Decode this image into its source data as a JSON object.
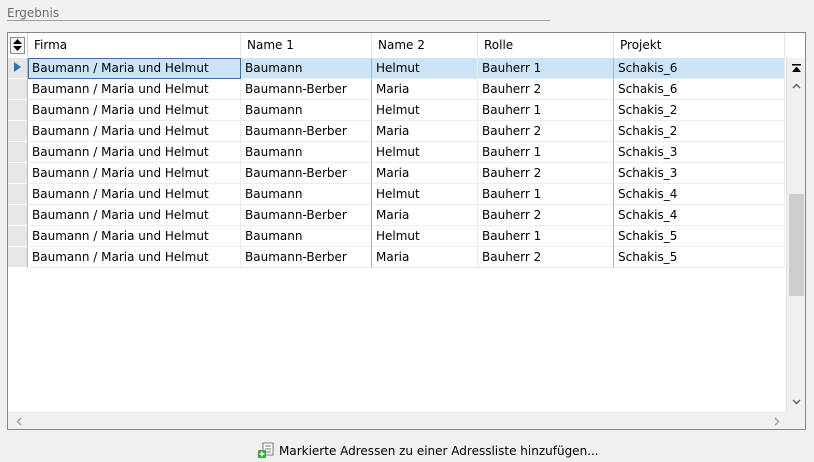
{
  "group": {
    "title": "Ergebnis"
  },
  "columns": [
    {
      "key": "firma",
      "label": "Firma"
    },
    {
      "key": "name1",
      "label": "Name 1"
    },
    {
      "key": "name2",
      "label": "Name 2"
    },
    {
      "key": "rolle",
      "label": "Rolle"
    },
    {
      "key": "projekt",
      "label": "Projekt"
    }
  ],
  "rows": [
    {
      "firma": "Baumann / Maria und Helmut",
      "name1": "Baumann",
      "name2": "Helmut",
      "rolle": "Bauherr 1",
      "projekt": "Schakis_6",
      "selected": true
    },
    {
      "firma": "Baumann / Maria und Helmut",
      "name1": "Baumann-Berber",
      "name2": "Maria",
      "rolle": "Bauherr 2",
      "projekt": "Schakis_6"
    },
    {
      "firma": "Baumann / Maria und Helmut",
      "name1": "Baumann",
      "name2": "Helmut",
      "rolle": "Bauherr 1",
      "projekt": "Schakis_2"
    },
    {
      "firma": "Baumann / Maria und Helmut",
      "name1": "Baumann-Berber",
      "name2": "Maria",
      "rolle": "Bauherr 2",
      "projekt": "Schakis_2"
    },
    {
      "firma": "Baumann / Maria und Helmut",
      "name1": "Baumann",
      "name2": "Helmut",
      "rolle": "Bauherr 1",
      "projekt": "Schakis_3"
    },
    {
      "firma": "Baumann / Maria und Helmut",
      "name1": "Baumann-Berber",
      "name2": "Maria",
      "rolle": "Bauherr 2",
      "projekt": "Schakis_3"
    },
    {
      "firma": "Baumann / Maria und Helmut",
      "name1": "Baumann",
      "name2": "Helmut",
      "rolle": "Bauherr 1",
      "projekt": "Schakis_4"
    },
    {
      "firma": "Baumann / Maria und Helmut",
      "name1": "Baumann-Berber",
      "name2": "Maria",
      "rolle": "Bauherr 2",
      "projekt": "Schakis_4"
    },
    {
      "firma": "Baumann / Maria und Helmut",
      "name1": "Baumann",
      "name2": "Helmut",
      "rolle": "Bauherr 1",
      "projekt": "Schakis_5"
    },
    {
      "firma": "Baumann / Maria und Helmut",
      "name1": "Baumann-Berber",
      "name2": "Maria",
      "rolle": "Bauherr 2",
      "projekt": "Schakis_5"
    }
  ],
  "icons": {
    "sort": "sort-toggle-icon",
    "row_indicator": "current-row-arrow-icon",
    "add_list": "add-to-list-icon"
  },
  "colors": {
    "selection": "#cce4f7",
    "row_indicator": "#1e78c8",
    "add_icon": "#3aa63a"
  },
  "actions": {
    "add_to_list_label": "Markierte Adressen zu einer Adressliste hinzufügen..."
  }
}
